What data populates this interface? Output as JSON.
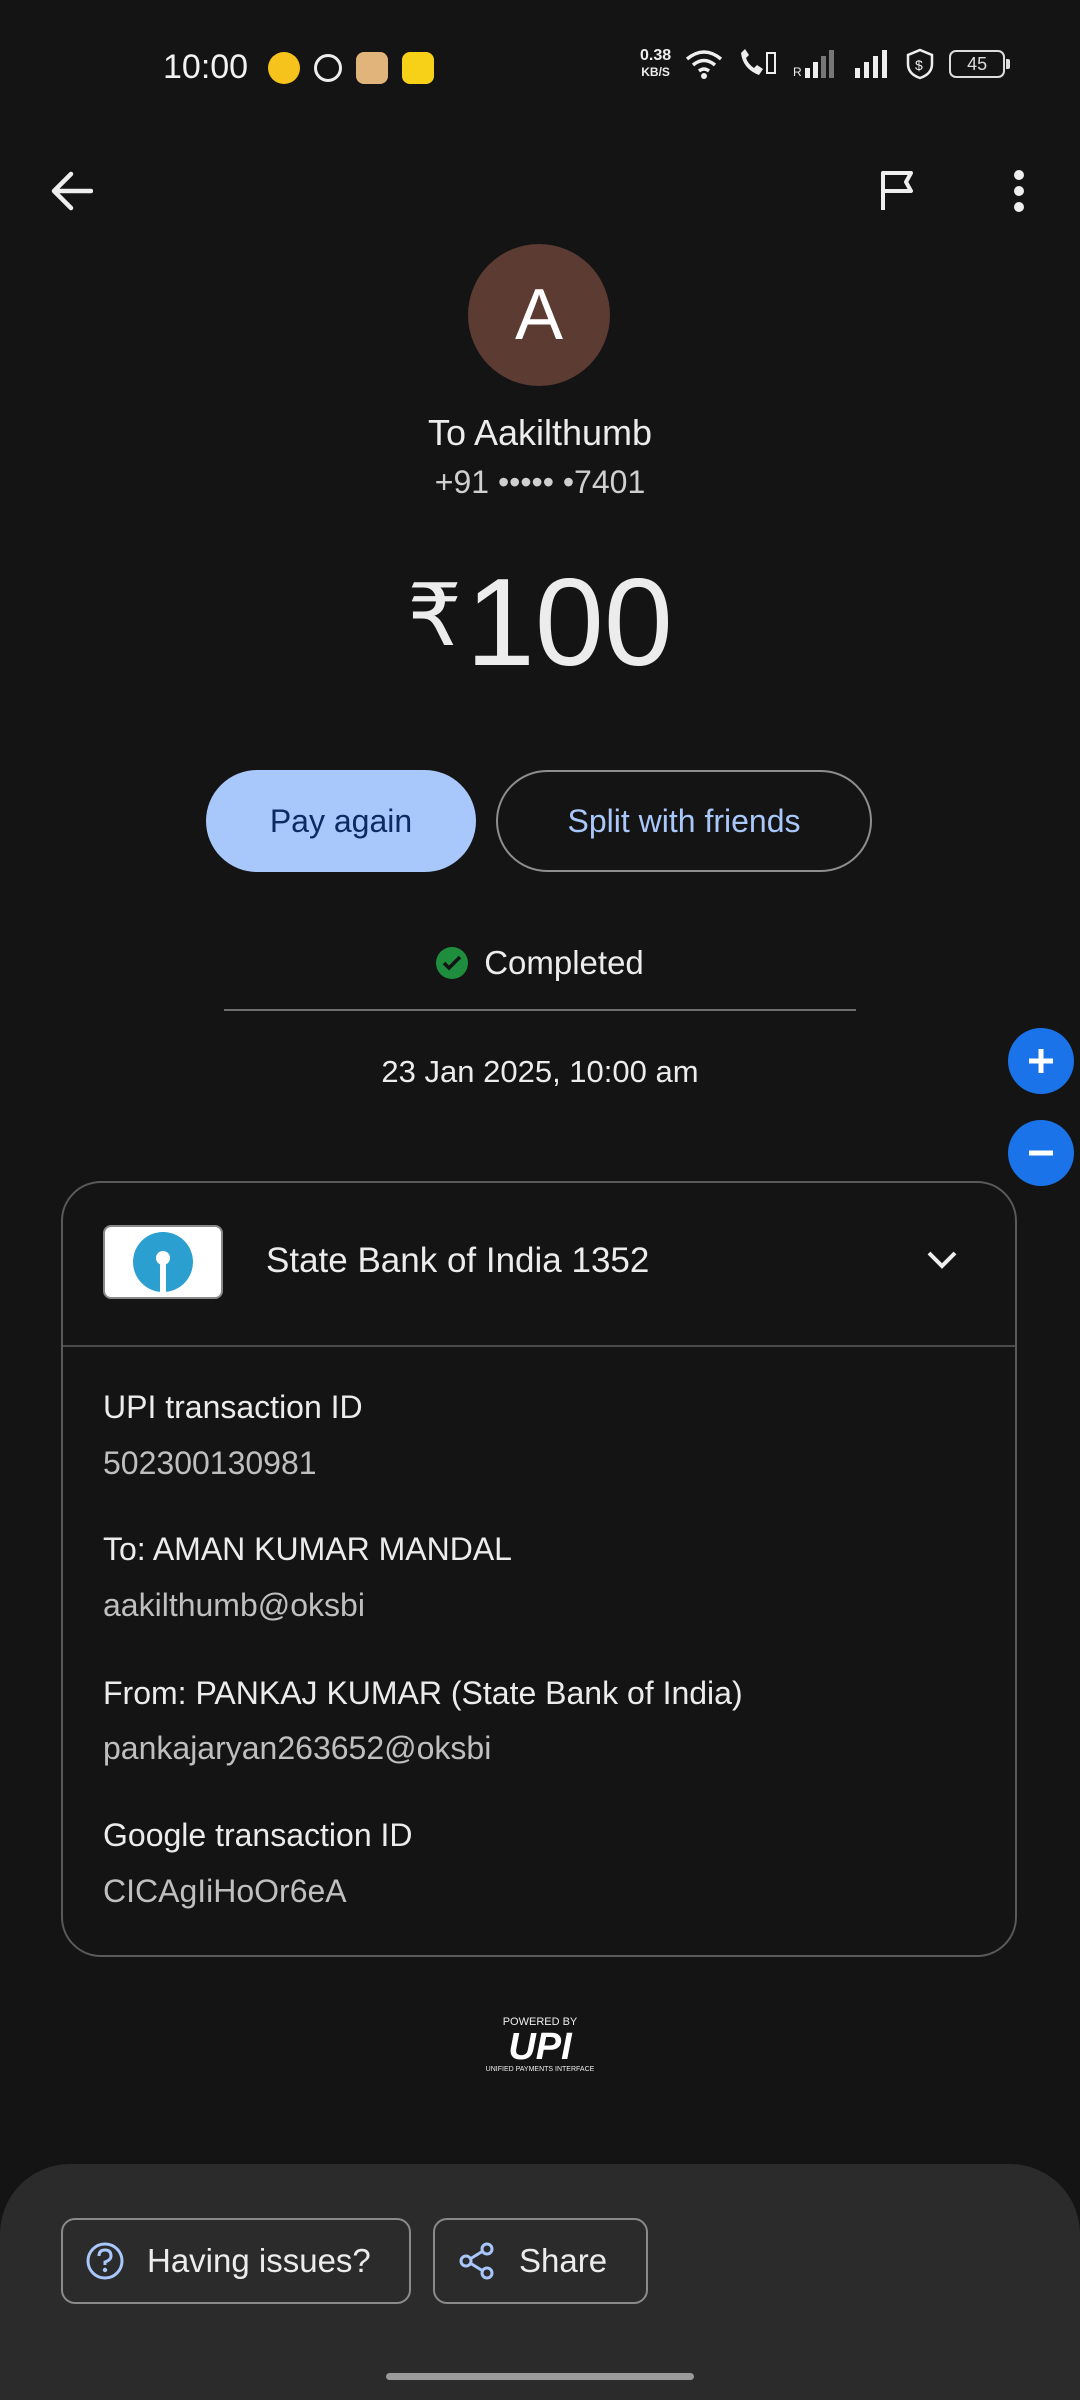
{
  "status_bar": {
    "time": "10:00",
    "speed_top": "0.38",
    "speed_bottom": "KB/S",
    "battery": "45",
    "icons": [
      "notification-app-icon",
      "threads-icon",
      "amazon-icon",
      "flipkart-icon",
      "wifi-icon",
      "volte-call-icon",
      "signal-icon",
      "signal-icon",
      "shield-dollar-icon"
    ]
  },
  "toolbar": {
    "icons": [
      "back-arrow-icon",
      "flag-icon",
      "more-vert-icon"
    ]
  },
  "recipient": {
    "initial": "A",
    "title": "To Aakilthumb",
    "phone": "+91 ••••• •7401"
  },
  "amount": {
    "currency": "₹",
    "value": "100"
  },
  "actions": {
    "pay_again": "Pay again",
    "split": "Split with friends"
  },
  "status": {
    "text": "Completed",
    "datetime": "23 Jan 2025, 10:00 am"
  },
  "details": {
    "bank": "State Bank of India 1352",
    "fields": [
      {
        "label": "UPI transaction ID",
        "value": "502300130981"
      },
      {
        "label": "To: AMAN KUMAR MANDAL",
        "value": "aakilthumb@oksbi"
      },
      {
        "label": "From: PANKAJ  KUMAR (State Bank of India)",
        "value": "pankajaryan263652@oksbi"
      },
      {
        "label": "Google transaction ID",
        "value": "CICAgIiHoOr6eA"
      }
    ]
  },
  "upi": {
    "powered": "POWERED BY",
    "brand": "UPI",
    "sub": "UNIFIED PAYMENTS INTERFACE"
  },
  "bottom": {
    "issues": "Having issues?",
    "share": "Share"
  },
  "colors": {
    "background": "#141414",
    "accent": "#a8c7fa",
    "zoom_button": "#1a73e8",
    "success": "#1e8e3e",
    "avatar": "#5c3b33"
  }
}
